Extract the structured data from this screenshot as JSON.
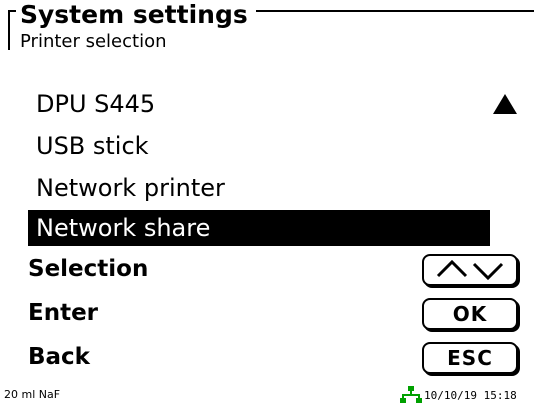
{
  "header": {
    "title": "System settings",
    "subtitle": "Printer selection"
  },
  "options": [
    {
      "label": "DPU S445",
      "selected": false
    },
    {
      "label": "USB stick",
      "selected": false
    },
    {
      "label": "Network printer",
      "selected": false
    },
    {
      "label": "Network share",
      "selected": true
    }
  ],
  "scroll_icon": "triangle-up-icon",
  "keys": {
    "selection_label": "Selection",
    "selection_icon": "up-down-arrows-icon",
    "enter_label": "Enter",
    "enter_button": "OK",
    "back_label": "Back",
    "back_button": "ESC"
  },
  "status": {
    "left_text": "20 ml NaF",
    "datetime": "10/10/19 15:18",
    "network_icon": "network-icon",
    "network_color": "#00a000"
  },
  "colors": {
    "selection_background": "#000000",
    "selection_text": "#ffffff"
  }
}
